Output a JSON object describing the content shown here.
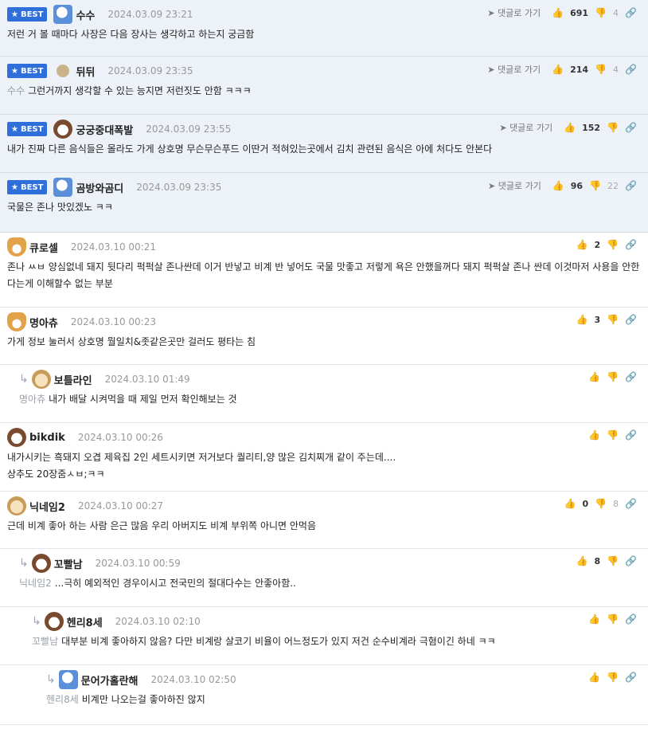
{
  "labels": {
    "best": "BEST",
    "reply": "댓글로 가기"
  },
  "comments": [
    {
      "nick": "수수",
      "date": "2024.03.09 23:21",
      "up": "691",
      "down": "4",
      "text": "저런 거 볼 때마다 사장은 다음 장사는 생각하고 하는지 궁금함"
    },
    {
      "nick": "뒤뒤",
      "date": "2024.03.09 23:35",
      "up": "214",
      "down": "4",
      "mention": "수수",
      "text": "그런거까지 생각할 수 있는 능지면 저런짓도 안함 ㅋㅋㅋ"
    },
    {
      "nick": "궁궁중대폭발",
      "date": "2024.03.09 23:55",
      "up": "152",
      "down": "",
      "text": "내가 진짜 다른 음식들은 몰라도 가게 상호명 무슨무슨푸드 이딴거 적혀있는곳에서 김치 관련된 음식은 아에 처다도 안본다"
    },
    {
      "nick": "곰방와곰디",
      "date": "2024.03.09 23:35",
      "up": "96",
      "down": "22",
      "text": "국물은 존나 맛있겠노 ㅋㅋ"
    },
    {
      "nick": "큐로셀",
      "date": "2024.03.10 00:21",
      "up": "2",
      "down": "",
      "text": "존나 ㅆㅂ 양심없네 돼지 뒷다리 퍽퍽살 존나싼데 이거 반넣고 비계 반 넣어도 국물 맛좋고 저렇게 욕은 안했을꺼다 돼지 퍽퍽살 존나 싼데 이것마저 사용을 안한다는게 이해할수 없는 부분"
    },
    {
      "nick": "명아츄",
      "date": "2024.03.10 00:23",
      "up": "3",
      "down": "",
      "text": "가게 정보 눌러서 상호명 뭘일치&좃같은곳만 걸러도 평타는 침"
    },
    {
      "nick": "보틀라인",
      "date": "2024.03.10 01:49",
      "up": "",
      "down": "",
      "mention": "명아츄",
      "text": "내가 배달 시켜먹을 때 제일 먼저 확인해보는 것"
    },
    {
      "nick": "bikdik",
      "date": "2024.03.10 00:26",
      "up": "",
      "down": "",
      "text": "내가시키는 흑돼지 오겹 제육집 2인 세트시키면 저거보다 퀄리티,양 많은 김치찌개 같이 주는데....",
      "text2": "상추도 20장줌ㅅㅂ;ㅋㅋ"
    },
    {
      "nick": "닉네임2",
      "date": "2024.03.10 00:27",
      "up": "0",
      "down": "8",
      "text": "근데 비계 좋아 하는 사람 은근 많음 우리 아버지도 비계 부위쪽 아니면 안먹음"
    },
    {
      "nick": "꼬빨남",
      "date": "2024.03.10 00:59",
      "up": "8",
      "down": "",
      "mention": "닉네임2",
      "text": "...극히 예외적인 경우이시고 전국민의 절대다수는 안좋아함.."
    },
    {
      "nick": "헨리8세",
      "date": "2024.03.10 02:10",
      "up": "",
      "down": "",
      "mention": "꼬빨남",
      "text": "대부분 비계 좋아하지 않음? 다만 비계랑 살코기 비율이 어느정도가 있지 저건 순수비계라 극혐이긴 하네 ㅋㅋ"
    },
    {
      "nick": "문어가홀란해",
      "date": "2024.03.10 02:50",
      "up": "",
      "down": "",
      "mention": "헨리8세",
      "text": "비계만 나오는걸 좋아하진 않지"
    }
  ]
}
